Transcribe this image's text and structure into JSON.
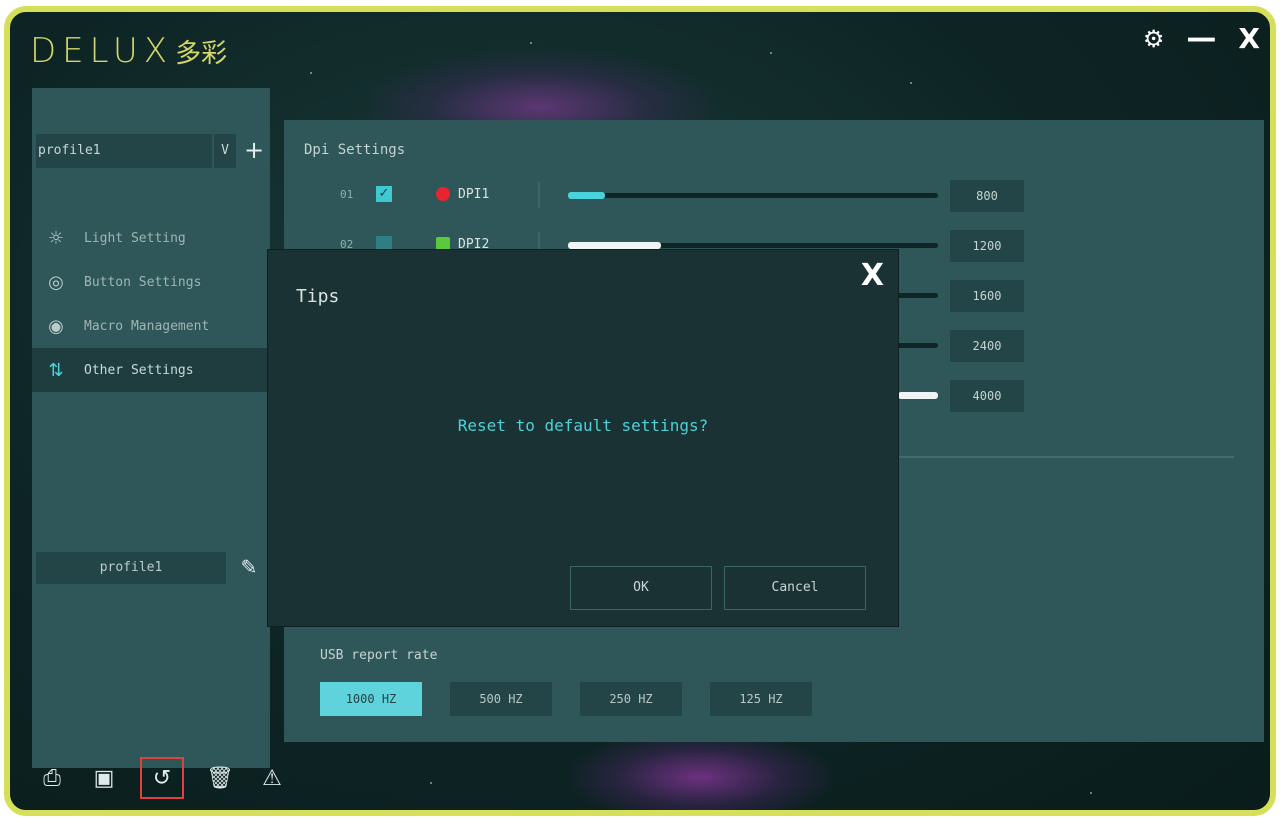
{
  "brand": {
    "logo_text": "DELUX",
    "logo_cn": "多彩"
  },
  "window": {
    "settings_icon": "gear-icon",
    "minimize_label": "—",
    "close_label": "X"
  },
  "sidebar": {
    "profile_select": {
      "value": "profile1",
      "arrow": "V",
      "add_label": "+"
    },
    "menu": [
      {
        "label": "Light Setting",
        "icon": "sun-icon",
        "glyph": "☼"
      },
      {
        "label": "Button Settings",
        "icon": "button-icon",
        "glyph": "◎"
      },
      {
        "label": "Macro Management",
        "icon": "macro-icon",
        "glyph": "◉"
      },
      {
        "label": "Other Settings",
        "icon": "sliders-icon",
        "glyph": "⇅",
        "active": true
      }
    ],
    "profile_name": "profile1",
    "edit_glyph": "✎"
  },
  "bottom_tools": [
    {
      "name": "import-icon",
      "glyph": "⎙"
    },
    {
      "name": "save-icon",
      "glyph": "▣"
    },
    {
      "name": "reset-icon",
      "glyph": "↺"
    },
    {
      "name": "delete-icon",
      "glyph": "🗑"
    },
    {
      "name": "warning-icon",
      "glyph": "⚠"
    }
  ],
  "dpi": {
    "title": "Dpi Settings",
    "rows": [
      {
        "num": "01",
        "checked": true,
        "dot_color": "#e8252f",
        "label": "DPI1",
        "level": 0.1,
        "fill": "cyan",
        "value": "800"
      },
      {
        "num": "02",
        "checked": false,
        "dot_color": "#5bc93c",
        "label": "DPI2",
        "level": 0.25,
        "fill": "white",
        "value": "1200"
      },
      {
        "value": "1600"
      },
      {
        "value": "2400"
      },
      {
        "value": "4000"
      }
    ]
  },
  "usb": {
    "title": "USB report rate",
    "rates": [
      {
        "label": "1000 HZ",
        "active": true
      },
      {
        "label": "500 HZ"
      },
      {
        "label": "250 HZ"
      },
      {
        "label": "125 HZ"
      }
    ]
  },
  "dialog": {
    "title": "Tips",
    "close_label": "X",
    "message": "Reset to default settings?",
    "ok_label": "OK",
    "cancel_label": "Cancel"
  }
}
